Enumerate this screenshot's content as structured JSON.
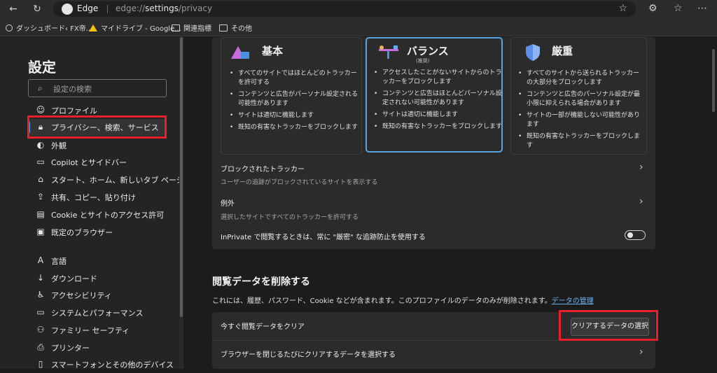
{
  "browser": {
    "brand": "Edge",
    "url_prefix": "edge://",
    "url_host": "settings",
    "url_path": "/privacy"
  },
  "bookmarks": [
    {
      "label": "ダッシュボード‹ FX帝...",
      "icon": "globe-icon"
    },
    {
      "label": "マイドライブ - Google...",
      "icon": "drive-icon"
    },
    {
      "label": "関連指標",
      "icon": "folder-icon"
    },
    {
      "label": "その他",
      "icon": "folder-icon"
    }
  ],
  "sidebar": {
    "title": "設定",
    "search_placeholder": "設定の検索",
    "items": [
      {
        "label": "プロファイル",
        "icon": "profile-icon"
      },
      {
        "label": "プライバシー、検索、サービス",
        "icon": "lock-icon",
        "active": true
      },
      {
        "label": "外観",
        "icon": "appearance-icon"
      },
      {
        "label": "Copilot とサイドバー",
        "icon": "sidebar-icon"
      },
      {
        "label": "スタート、ホーム、新しいタブ ページ",
        "icon": "home-icon"
      },
      {
        "label": "共有、コピー、貼り付け",
        "icon": "share-icon"
      },
      {
        "label": "Cookie とサイトのアクセス許可",
        "icon": "cookie-icon"
      },
      {
        "label": "既定のブラウザー",
        "icon": "browser-icon"
      },
      {
        "label": "言語",
        "icon": "language-icon"
      },
      {
        "label": "ダウンロード",
        "icon": "download-icon"
      },
      {
        "label": "アクセシビリティ",
        "icon": "accessibility-icon"
      },
      {
        "label": "システムとパフォーマンス",
        "icon": "system-icon"
      },
      {
        "label": "ファミリー セーフティ",
        "icon": "family-icon"
      },
      {
        "label": "プリンター",
        "icon": "printer-icon"
      },
      {
        "label": "スマートフォンとその他のデバイス",
        "icon": "phone-icon"
      }
    ]
  },
  "tracking": {
    "cards": [
      {
        "title": "基本",
        "subtitle": "",
        "bullets": [
          "すべてのサイトではほとんどのトラッカーを許可する",
          "コンテンツと広告がパーソナル設定される可能性があります",
          "サイトは適切に機能します",
          "既知の有害なトラッカーをブロックします"
        ]
      },
      {
        "title": "バランス",
        "subtitle": "(推奨)",
        "bullets": [
          "アクセスしたことがないサイトからのトラッカーをブロックします",
          "コンテンツと広告はほとんどパーソナル設定されない可能性があります",
          "サイトは適切に機能します",
          "既知の有害なトラッカーをブロックします"
        ]
      },
      {
        "title": "厳重",
        "subtitle": "",
        "bullets": [
          "すべてのサイトから送られるトラッカーの大部分をブロックします",
          "コンテンツと広告のパーソナル設定が最小限に抑えられる場合があります",
          "サイトの一部が機能しない可能性があります",
          "既知の有害なトラッカーをブロックします"
        ]
      }
    ],
    "blocked_title": "ブロックされたトラッカー",
    "blocked_desc": "ユーザーの追跡がブロックされているサイトを表示する",
    "exceptions_title": "例外",
    "exceptions_desc": "選択したサイトですべてのトラッカーを許可する",
    "inprivate_label": "InPrivate で閲覧するときは、常に \"厳密\" な追跡防止を使用する"
  },
  "clear_data": {
    "title": "閲覧データを削除する",
    "desc": "これには、履歴、パスワード、Cookie などが含まれます。このプロファイルのデータのみが削除されます。",
    "manage_link": "データの管理",
    "clear_now_label": "今すぐ閲覧データをクリア",
    "choose_button": "クリアするデータの選択",
    "on_close_label": "ブラウザーを閉じるたびにクリアするデータを選択する"
  },
  "colors": {
    "accent": "#58a6e6",
    "highlight": "#e8202a"
  }
}
